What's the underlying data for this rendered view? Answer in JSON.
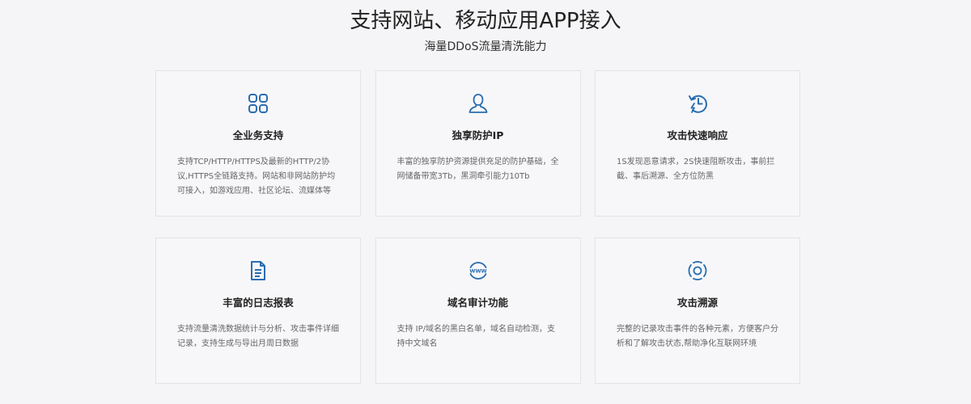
{
  "header": {
    "title": "支持网站、移动应用APP接入",
    "subtitle": "海量DDoS流量清洗能力"
  },
  "accent_color": "#2a6db0",
  "cards": [
    {
      "icon": "grid-icon",
      "title": "全业务支持",
      "desc": "支持TCP/HTTP/HTTPS及最新的HTTP/2协议,HTTPS全链路支持。网站和非网站防护均可接入，如游戏应用、社区论坛、流媒体等"
    },
    {
      "icon": "user-icon",
      "title": "独享防护IP",
      "desc": "丰富的独享防护资源提供充足的防护基础，全网储备带宽3Tb，黑洞牵引能力10Tb"
    },
    {
      "icon": "fast-clock-icon",
      "title": "攻击快速响应",
      "desc": "1S发现恶意请求，2S快速阻断攻击，事前拦截、事后溯源、全方位防黑"
    },
    {
      "icon": "document-icon",
      "title": "丰富的日志报表",
      "desc": "支持流量清洗数据统计与分析、攻击事件详细记录，支持生成与导出月周日数据"
    },
    {
      "icon": "www-globe-icon",
      "title": "域名审计功能",
      "desc": "支持 IP/域名的黑白名单，域名自动检测，支持中文域名"
    },
    {
      "icon": "target-icon",
      "title": "攻击溯源",
      "desc": "完整的记录攻击事件的各种元素，方便客户分析和了解攻击状态,帮助净化互联网环境"
    }
  ]
}
